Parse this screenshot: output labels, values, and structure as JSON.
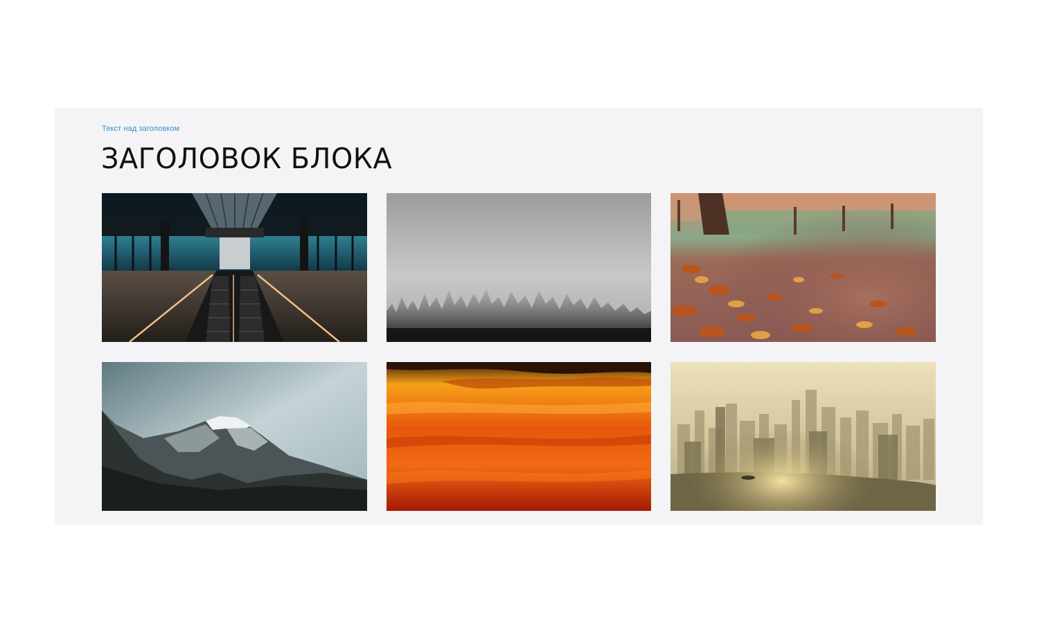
{
  "block": {
    "overline": "Текст над заголовком",
    "title": "ЗАГОЛОВОК БЛОКА"
  },
  "colors": {
    "background": "#ffffff",
    "block_background": "#f4f4f6",
    "overline": "#3d8fc7",
    "title": "#111111"
  },
  "gallery": [
    {
      "subject": "escalator-station-photo"
    },
    {
      "subject": "foggy-forest-photo"
    },
    {
      "subject": "autumn-leaves-path-photo"
    },
    {
      "subject": "snowy-mountain-photo"
    },
    {
      "subject": "orange-sunset-sky-photo"
    },
    {
      "subject": "hazy-city-skyline-photo"
    }
  ]
}
